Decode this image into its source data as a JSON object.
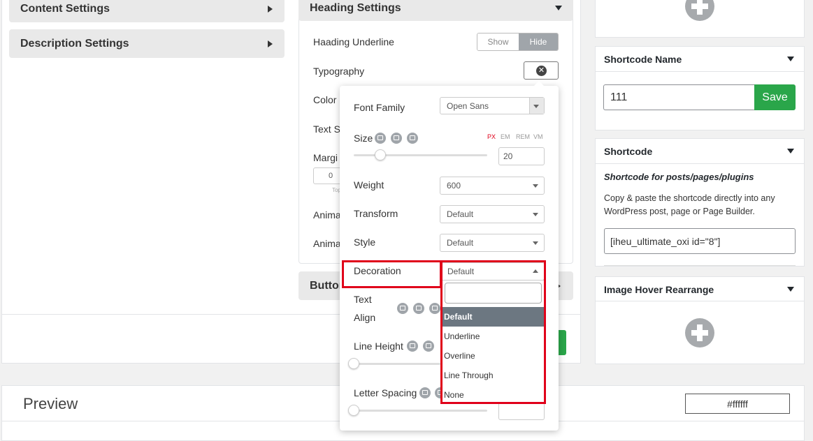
{
  "left": {
    "content_settings": "Content Settings",
    "description_settings": "Description Settings"
  },
  "heading": {
    "title": "Heading Settings",
    "underline_label": "Haading Underline",
    "toggle_show": "Show",
    "toggle_hide": "Hide",
    "typography_label": "Typography",
    "color_label": "Color",
    "text_label_partial": "Text Sl",
    "margin_label_partial": "Margi",
    "margin_value": "0",
    "margin_sub": "Top",
    "anim1_partial": "Anima",
    "anim2_partial": "Anima",
    "button_partial": "Button"
  },
  "popup": {
    "font_family_label": "Font Family",
    "font_family_value": "Open Sans",
    "size_label": "Size",
    "units": [
      "PX",
      "EM",
      "REM",
      "VM"
    ],
    "size_value": "20",
    "size_slider": 0.2,
    "weight_label": "Weight",
    "weight_value": "600",
    "transform_label": "Transform",
    "transform_value": "Default",
    "style_label": "Style",
    "style_value": "Default",
    "decoration_label": "Decoration",
    "decoration_value": "Default",
    "decoration_search": "",
    "decoration_options": [
      "Default",
      "Underline",
      "Overline",
      "Line Through",
      "None"
    ],
    "text_align_line1": "Text",
    "text_align_line2": "Align",
    "line_height_label": "Line Height",
    "letter_spacing_label": "Letter Spacing"
  },
  "right": {
    "shortcode_name_title": "Shortcode Name",
    "shortcode_name_value": "111",
    "save_label": "Save",
    "shortcode_title": "Shortcode",
    "shortcode_subtitle": "Shortcode for posts/pages/plugins",
    "shortcode_desc": "Copy & paste the shortcode directly into any WordPress post, page or Page Builder.",
    "shortcode_value": "[iheu_ultimate_oxi id=\"8\"]",
    "rearrange_title": "Image Hover Rearrange"
  },
  "preview": {
    "title": "Preview",
    "bg_color": "#ffffff"
  },
  "colors": {
    "accent_green": "#2aa64a",
    "highlight_red": "#e0001a",
    "selected_option": "#6c7781"
  }
}
